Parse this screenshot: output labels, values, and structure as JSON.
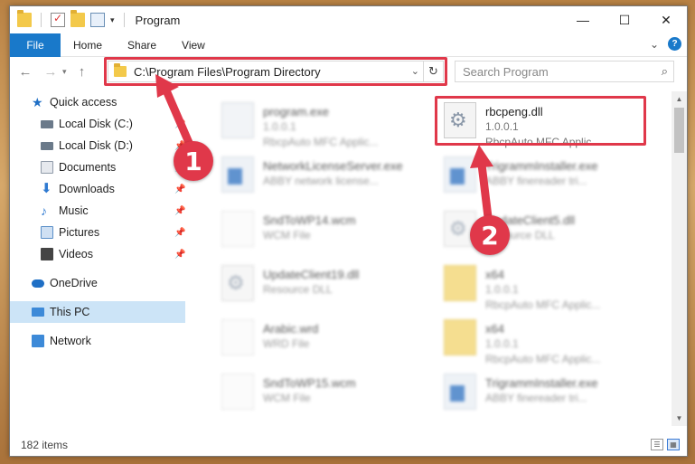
{
  "window": {
    "title": "Program",
    "controls": {
      "minimize": "—",
      "maximize": "☐",
      "close": "✕"
    }
  },
  "ribbon": {
    "tabs": [
      "File",
      "Home",
      "Share",
      "View"
    ],
    "help": "?"
  },
  "nav": {
    "back": "←",
    "forward": "→",
    "up": "↑",
    "address": "C:\\Program Files\\Program Directory",
    "refresh": "↻",
    "search_placeholder": "Search Program",
    "search_icon": "⌕"
  },
  "sidebar": {
    "items": [
      {
        "label": "Quick access",
        "icon": "star-icon",
        "color": "#1f6fc5",
        "pinned": false
      },
      {
        "label": "Local Disk (C:)",
        "icon": "drive-icon",
        "color": "#6b7a8a",
        "pinned": true
      },
      {
        "label": "Local Disk (D:)",
        "icon": "drive-icon",
        "color": "#6b7a8a",
        "pinned": true
      },
      {
        "label": "Documents",
        "icon": "documents-icon",
        "color": "#8f9aa8",
        "pinned": true
      },
      {
        "label": "Downloads",
        "icon": "downloads-icon",
        "color": "#2f7ad1",
        "pinned": true
      },
      {
        "label": "Music",
        "icon": "music-icon",
        "color": "#2f7ad1",
        "pinned": true
      },
      {
        "label": "Pictures",
        "icon": "pictures-icon",
        "color": "#5a8fc8",
        "pinned": true
      },
      {
        "label": "Videos",
        "icon": "videos-icon",
        "color": "#444444",
        "pinned": true
      }
    ],
    "onedrive": "OneDrive",
    "this_pc": "This PC",
    "network": "Network"
  },
  "files": {
    "left": [
      {
        "name": "program.exe",
        "line2": "1.0.0.1",
        "line3": "RbcpAuto MFC Applic...",
        "icon": "app"
      },
      {
        "name": "NetworkLicenseServer.exe",
        "line2": "ABBY network license...",
        "icon": "exe"
      },
      {
        "name": "SndToWP14.wcm",
        "line2": "WCM File",
        "icon": "doc"
      },
      {
        "name": "UpdateClient19.dll",
        "line2": "Resource DLL",
        "icon": "dll"
      },
      {
        "name": "Arabic.wrd",
        "line2": "WRD File",
        "icon": "doc"
      },
      {
        "name": "SndToWP15.wcm",
        "line2": "WCM File",
        "icon": "doc"
      }
    ],
    "right": [
      {
        "name": "rbcpeng.dll",
        "line2": "1.0.0.1",
        "line3": "RbcpAuto MFC Applic...",
        "icon": "dll"
      },
      {
        "name": "TrigrammInstaller.exe",
        "line2": "ABBY finereader tri...",
        "icon": "exe"
      },
      {
        "name": "UpdateClient5.dll",
        "line2": "Resource DLL",
        "icon": "dll"
      },
      {
        "name": "x64",
        "line2": "1.0.0.1",
        "line3": "RbcpAuto MFC Applic...",
        "icon": "folder"
      },
      {
        "name": "x64",
        "line2": "1.0.0.1",
        "line3": "RbcpAuto MFC Applic...",
        "icon": "folder"
      },
      {
        "name": "TrigrammInstaller.exe",
        "line2": "ABBY finereader tri...",
        "icon": "exe"
      }
    ]
  },
  "status": {
    "items": "182 items"
  },
  "annotations": {
    "step1": "1",
    "step2": "2",
    "color": "#e0384a"
  }
}
